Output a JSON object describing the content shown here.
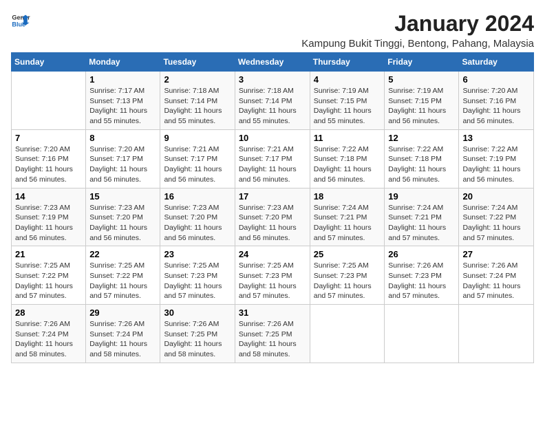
{
  "logo": {
    "text_general": "General",
    "text_blue": "Blue"
  },
  "title": "January 2024",
  "subtitle": "Kampung Bukit Tinggi, Bentong, Pahang, Malaysia",
  "days_of_week": [
    "Sunday",
    "Monday",
    "Tuesday",
    "Wednesday",
    "Thursday",
    "Friday",
    "Saturday"
  ],
  "weeks": [
    [
      {
        "day": "",
        "sunrise": "",
        "sunset": "",
        "daylight": ""
      },
      {
        "day": "1",
        "sunrise": "Sunrise: 7:17 AM",
        "sunset": "Sunset: 7:13 PM",
        "daylight": "Daylight: 11 hours and 55 minutes."
      },
      {
        "day": "2",
        "sunrise": "Sunrise: 7:18 AM",
        "sunset": "Sunset: 7:14 PM",
        "daylight": "Daylight: 11 hours and 55 minutes."
      },
      {
        "day": "3",
        "sunrise": "Sunrise: 7:18 AM",
        "sunset": "Sunset: 7:14 PM",
        "daylight": "Daylight: 11 hours and 55 minutes."
      },
      {
        "day": "4",
        "sunrise": "Sunrise: 7:19 AM",
        "sunset": "Sunset: 7:15 PM",
        "daylight": "Daylight: 11 hours and 55 minutes."
      },
      {
        "day": "5",
        "sunrise": "Sunrise: 7:19 AM",
        "sunset": "Sunset: 7:15 PM",
        "daylight": "Daylight: 11 hours and 56 minutes."
      },
      {
        "day": "6",
        "sunrise": "Sunrise: 7:20 AM",
        "sunset": "Sunset: 7:16 PM",
        "daylight": "Daylight: 11 hours and 56 minutes."
      }
    ],
    [
      {
        "day": "7",
        "sunrise": "Sunrise: 7:20 AM",
        "sunset": "Sunset: 7:16 PM",
        "daylight": "Daylight: 11 hours and 56 minutes."
      },
      {
        "day": "8",
        "sunrise": "Sunrise: 7:20 AM",
        "sunset": "Sunset: 7:17 PM",
        "daylight": "Daylight: 11 hours and 56 minutes."
      },
      {
        "day": "9",
        "sunrise": "Sunrise: 7:21 AM",
        "sunset": "Sunset: 7:17 PM",
        "daylight": "Daylight: 11 hours and 56 minutes."
      },
      {
        "day": "10",
        "sunrise": "Sunrise: 7:21 AM",
        "sunset": "Sunset: 7:17 PM",
        "daylight": "Daylight: 11 hours and 56 minutes."
      },
      {
        "day": "11",
        "sunrise": "Sunrise: 7:22 AM",
        "sunset": "Sunset: 7:18 PM",
        "daylight": "Daylight: 11 hours and 56 minutes."
      },
      {
        "day": "12",
        "sunrise": "Sunrise: 7:22 AM",
        "sunset": "Sunset: 7:18 PM",
        "daylight": "Daylight: 11 hours and 56 minutes."
      },
      {
        "day": "13",
        "sunrise": "Sunrise: 7:22 AM",
        "sunset": "Sunset: 7:19 PM",
        "daylight": "Daylight: 11 hours and 56 minutes."
      }
    ],
    [
      {
        "day": "14",
        "sunrise": "Sunrise: 7:23 AM",
        "sunset": "Sunset: 7:19 PM",
        "daylight": "Daylight: 11 hours and 56 minutes."
      },
      {
        "day": "15",
        "sunrise": "Sunrise: 7:23 AM",
        "sunset": "Sunset: 7:20 PM",
        "daylight": "Daylight: 11 hours and 56 minutes."
      },
      {
        "day": "16",
        "sunrise": "Sunrise: 7:23 AM",
        "sunset": "Sunset: 7:20 PM",
        "daylight": "Daylight: 11 hours and 56 minutes."
      },
      {
        "day": "17",
        "sunrise": "Sunrise: 7:23 AM",
        "sunset": "Sunset: 7:20 PM",
        "daylight": "Daylight: 11 hours and 56 minutes."
      },
      {
        "day": "18",
        "sunrise": "Sunrise: 7:24 AM",
        "sunset": "Sunset: 7:21 PM",
        "daylight": "Daylight: 11 hours and 57 minutes."
      },
      {
        "day": "19",
        "sunrise": "Sunrise: 7:24 AM",
        "sunset": "Sunset: 7:21 PM",
        "daylight": "Daylight: 11 hours and 57 minutes."
      },
      {
        "day": "20",
        "sunrise": "Sunrise: 7:24 AM",
        "sunset": "Sunset: 7:22 PM",
        "daylight": "Daylight: 11 hours and 57 minutes."
      }
    ],
    [
      {
        "day": "21",
        "sunrise": "Sunrise: 7:25 AM",
        "sunset": "Sunset: 7:22 PM",
        "daylight": "Daylight: 11 hours and 57 minutes."
      },
      {
        "day": "22",
        "sunrise": "Sunrise: 7:25 AM",
        "sunset": "Sunset: 7:22 PM",
        "daylight": "Daylight: 11 hours and 57 minutes."
      },
      {
        "day": "23",
        "sunrise": "Sunrise: 7:25 AM",
        "sunset": "Sunset: 7:23 PM",
        "daylight": "Daylight: 11 hours and 57 minutes."
      },
      {
        "day": "24",
        "sunrise": "Sunrise: 7:25 AM",
        "sunset": "Sunset: 7:23 PM",
        "daylight": "Daylight: 11 hours and 57 minutes."
      },
      {
        "day": "25",
        "sunrise": "Sunrise: 7:25 AM",
        "sunset": "Sunset: 7:23 PM",
        "daylight": "Daylight: 11 hours and 57 minutes."
      },
      {
        "day": "26",
        "sunrise": "Sunrise: 7:26 AM",
        "sunset": "Sunset: 7:23 PM",
        "daylight": "Daylight: 11 hours and 57 minutes."
      },
      {
        "day": "27",
        "sunrise": "Sunrise: 7:26 AM",
        "sunset": "Sunset: 7:24 PM",
        "daylight": "Daylight: 11 hours and 57 minutes."
      }
    ],
    [
      {
        "day": "28",
        "sunrise": "Sunrise: 7:26 AM",
        "sunset": "Sunset: 7:24 PM",
        "daylight": "Daylight: 11 hours and 58 minutes."
      },
      {
        "day": "29",
        "sunrise": "Sunrise: 7:26 AM",
        "sunset": "Sunset: 7:24 PM",
        "daylight": "Daylight: 11 hours and 58 minutes."
      },
      {
        "day": "30",
        "sunrise": "Sunrise: 7:26 AM",
        "sunset": "Sunset: 7:25 PM",
        "daylight": "Daylight: 11 hours and 58 minutes."
      },
      {
        "day": "31",
        "sunrise": "Sunrise: 7:26 AM",
        "sunset": "Sunset: 7:25 PM",
        "daylight": "Daylight: 11 hours and 58 minutes."
      },
      {
        "day": "",
        "sunrise": "",
        "sunset": "",
        "daylight": ""
      },
      {
        "day": "",
        "sunrise": "",
        "sunset": "",
        "daylight": ""
      },
      {
        "day": "",
        "sunrise": "",
        "sunset": "",
        "daylight": ""
      }
    ]
  ]
}
